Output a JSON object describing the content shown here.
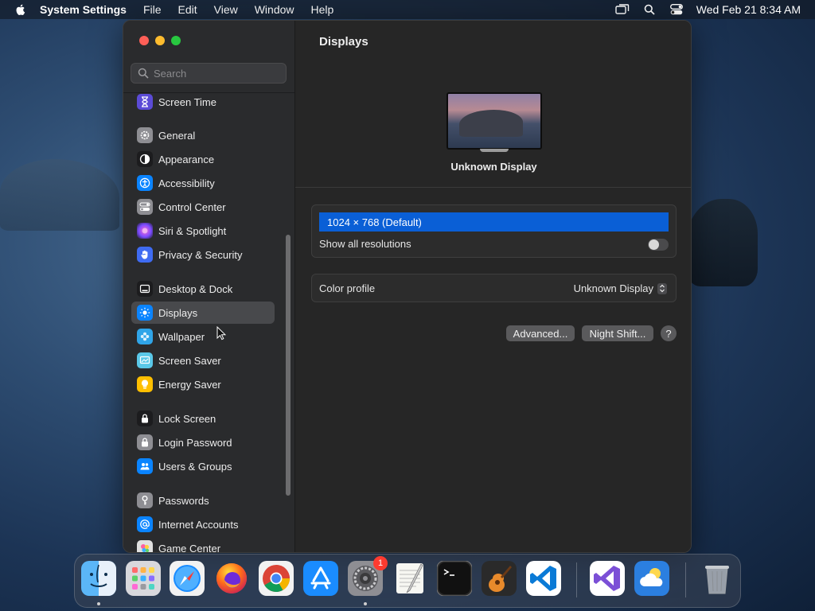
{
  "menubar": {
    "app_name": "System Settings",
    "menus": [
      "File",
      "Edit",
      "View",
      "Window",
      "Help"
    ],
    "clock": "Wed Feb 21  8:34 AM"
  },
  "sidebar": {
    "search_placeholder": "Search",
    "items": [
      {
        "label": "Screen Time",
        "icon": "hourglass-icon",
        "color": "#5b4bd6"
      },
      {
        "label": "General",
        "icon": "gear-icon",
        "color": "#8e8e93"
      },
      {
        "label": "Appearance",
        "icon": "appearance-icon",
        "color": "#1c1c1e"
      },
      {
        "label": "Accessibility",
        "icon": "accessibility-icon",
        "color": "#0a84ff"
      },
      {
        "label": "Control Center",
        "icon": "control-center-icon",
        "color": "#8e8e93"
      },
      {
        "label": "Siri & Spotlight",
        "icon": "siri-icon",
        "color": "#b04fd6"
      },
      {
        "label": "Privacy & Security",
        "icon": "hand-icon",
        "color": "#3f6bf2"
      },
      {
        "label": "Desktop & Dock",
        "icon": "dock-icon",
        "color": "#1c1c1e"
      },
      {
        "label": "Displays",
        "icon": "sun-icon",
        "color": "#0a84ff"
      },
      {
        "label": "Wallpaper",
        "icon": "flower-icon",
        "color": "#30a5e8"
      },
      {
        "label": "Screen Saver",
        "icon": "screen-saver-icon",
        "color": "#5ac8e8"
      },
      {
        "label": "Energy Saver",
        "icon": "bulb-icon",
        "color": "#ffbf00"
      },
      {
        "label": "Lock Screen",
        "icon": "lock-icon",
        "color": "#1c1c1e"
      },
      {
        "label": "Login Password",
        "icon": "lock-icon",
        "color": "#8e8e93"
      },
      {
        "label": "Users & Groups",
        "icon": "users-icon",
        "color": "#0a84ff"
      },
      {
        "label": "Passwords",
        "icon": "key-icon",
        "color": "#8e8e93"
      },
      {
        "label": "Internet Accounts",
        "icon": "at-icon",
        "color": "#0a84ff"
      },
      {
        "label": "Game Center",
        "icon": "game-center-icon",
        "color": "#e0e0e0"
      }
    ]
  },
  "main": {
    "title": "Displays",
    "display_name": "Unknown Display",
    "resolution_selected": "1024 × 768 (Default)",
    "show_all_resolutions_label": "Show all resolutions",
    "color_profile_label": "Color profile",
    "color_profile_value": "Unknown Display",
    "advanced_button": "Advanced...",
    "night_shift_button": "Night Shift...",
    "help_button": "?"
  },
  "dock": {
    "apps": [
      {
        "name": "finder-icon"
      },
      {
        "name": "launchpad-icon"
      },
      {
        "name": "safari-icon"
      },
      {
        "name": "firefox-icon"
      },
      {
        "name": "chrome-icon"
      },
      {
        "name": "app-store-icon"
      },
      {
        "name": "system-settings-icon",
        "badge": "1"
      },
      {
        "name": "textedit-icon"
      },
      {
        "name": "terminal-icon"
      },
      {
        "name": "garageband-icon"
      },
      {
        "name": "vscode-icon"
      },
      {
        "name": "visual-studio-icon"
      },
      {
        "name": "weather-icon"
      },
      {
        "name": "trash-icon"
      }
    ]
  },
  "colors": {
    "accent": "#0a5fd6",
    "close": "#fe5f57",
    "minimize": "#febc2e",
    "maximize": "#28c840"
  }
}
